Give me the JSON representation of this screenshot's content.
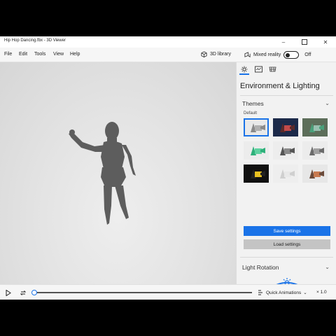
{
  "window": {
    "title": "Hip Hop Dancing.fbx - 3D Viewer"
  },
  "menu": {
    "file": "File",
    "edit": "Edit",
    "tools": "Tools",
    "view": "View",
    "help": "Help"
  },
  "toolbar": {
    "library": "3D library",
    "mixed_reality": "Mixed reality",
    "toggle_state": "Off"
  },
  "panel": {
    "tabs": [
      "sun-icon",
      "stats-icon",
      "grid-icon"
    ],
    "title": "Environment & Lighting",
    "themes_label": "Themes",
    "default_label": "Default",
    "save_label": "Save settings",
    "load_label": "Load settings",
    "light_rotation_label": "Light Rotation"
  },
  "themes": [
    {
      "bg": "#e9e9e9",
      "obj": "#8a8a8a",
      "accent": "#b0b0b0"
    },
    {
      "bg": "#1c2a4a",
      "obj": "#5a2a2a",
      "accent": "#c24a4a"
    },
    {
      "bg": "#5d6e5a",
      "obj": "#4aa07a",
      "accent": "#99c0b0"
    },
    {
      "bg": "#ececec",
      "obj": "#2eb07a",
      "accent": "#5ed1a0"
    },
    {
      "bg": "#ededed",
      "obj": "#555555",
      "accent": "#8a8a8a"
    },
    {
      "bg": "#ececec",
      "obj": "#6a6a6a",
      "accent": "#a0a0a0"
    },
    {
      "bg": "#111111",
      "obj": "#222222",
      "accent": "#e8c020"
    },
    {
      "bg": "#eeeeee",
      "obj": "#cfcfcf",
      "accent": "#e8e8e8"
    },
    {
      "bg": "#e7e7e7",
      "obj": "#6b4a3a",
      "accent": "#c87a50"
    }
  ],
  "playback": {
    "quick_animations": "Quick Animations",
    "speed": "× 1.0"
  },
  "colors": {
    "accent": "#1a73e8",
    "figure": "#5d5d5d"
  }
}
